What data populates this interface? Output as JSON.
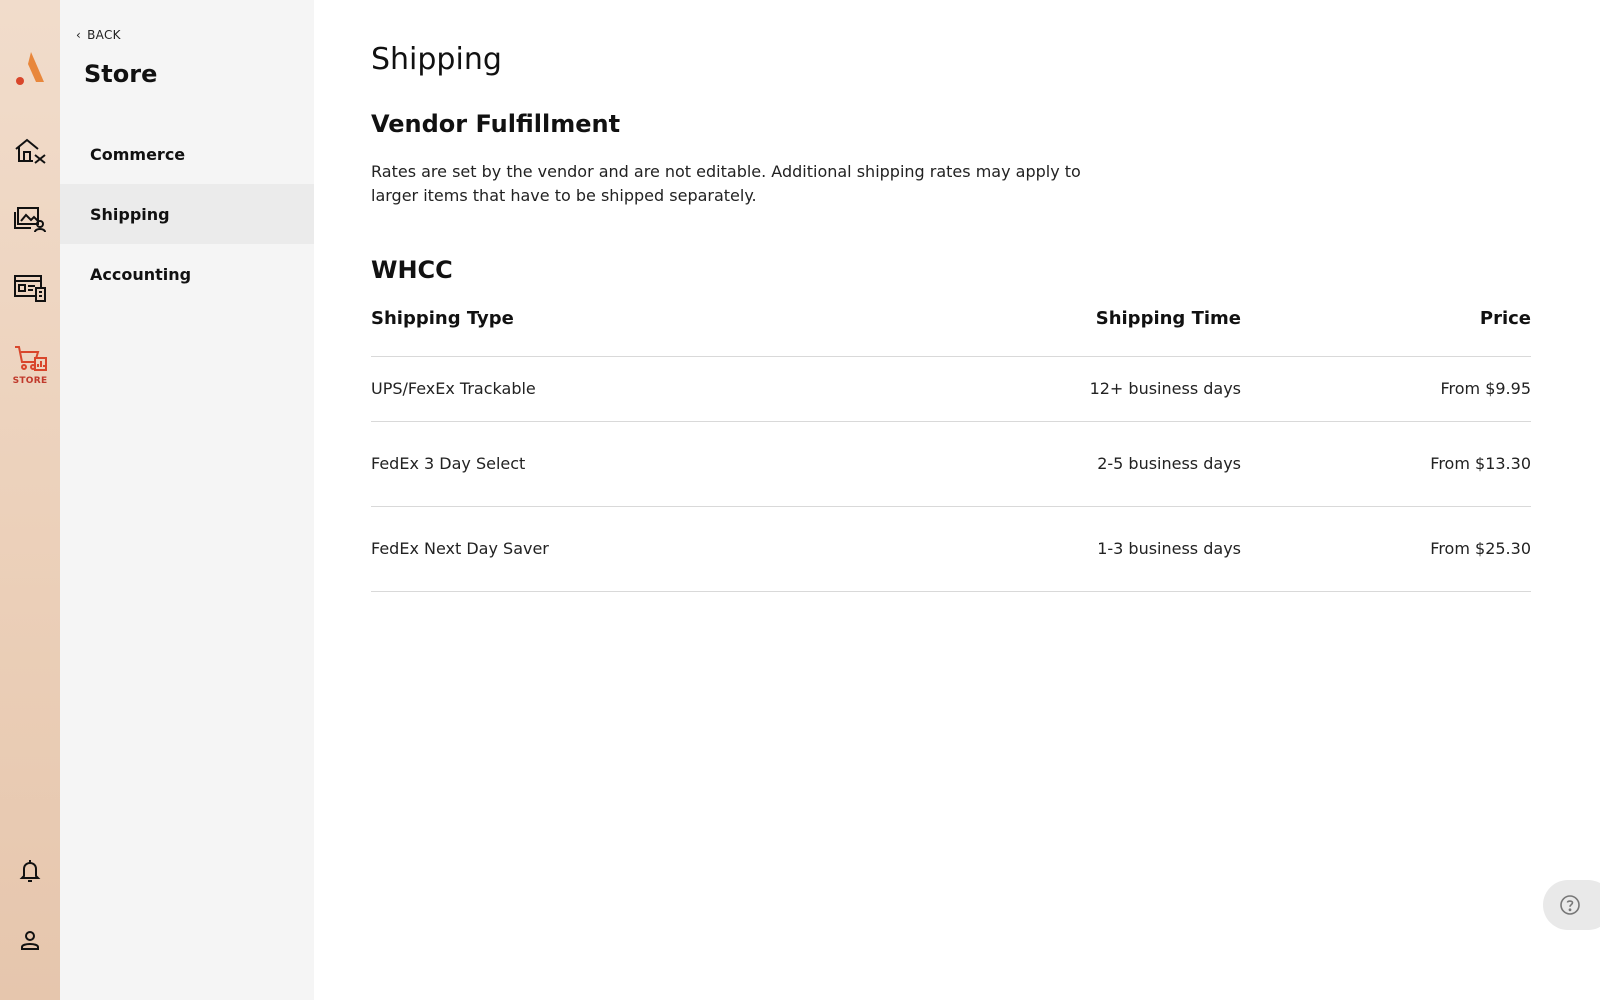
{
  "rail": {
    "items": [
      {
        "name": "home-settings-icon"
      },
      {
        "name": "gallery-client-icon"
      },
      {
        "name": "website-builder-icon"
      },
      {
        "name": "store-cart-icon",
        "label": "STORE",
        "active": true
      }
    ],
    "bottom": [
      {
        "name": "bell-icon"
      },
      {
        "name": "profile-icon"
      }
    ],
    "accent": "#d9462b"
  },
  "subnav": {
    "back_label": "BACK",
    "title": "Store",
    "items": [
      {
        "label": "Commerce",
        "active": false
      },
      {
        "label": "Shipping",
        "active": true
      },
      {
        "label": "Accounting",
        "active": false
      }
    ]
  },
  "main": {
    "page_title": "Shipping",
    "vendor": {
      "title": "Vendor Fulfillment",
      "description": "Rates are set by the vendor and are not editable. Additional shipping rates may apply to larger items that have to be shipped separately."
    },
    "lab": {
      "title": "WHCC",
      "columns": [
        "Shipping Type",
        "Shipping Time",
        "Price"
      ],
      "rows": [
        {
          "type": "UPS/FexEx Trackable",
          "time": "12+ business days",
          "price": "From $9.95"
        },
        {
          "type": "FedEx 3 Day Select",
          "time": "2-5 business days",
          "price": "From $13.30"
        },
        {
          "type": "FedEx Next Day Saver",
          "time": "1-3 business days",
          "price": "From $25.30"
        }
      ]
    }
  },
  "help": {
    "icon": "help-icon"
  }
}
